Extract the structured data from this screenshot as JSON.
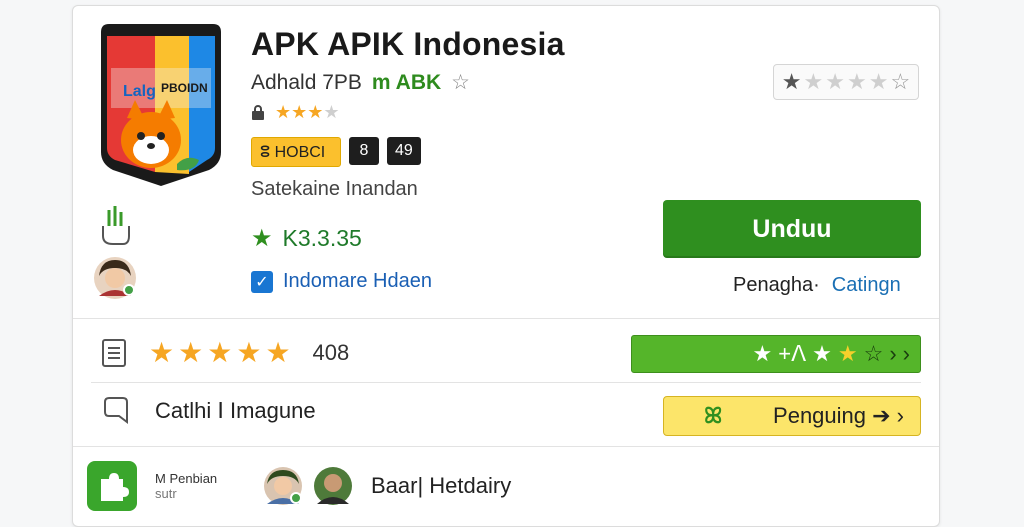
{
  "app": {
    "title": "APK APIK Indonesia",
    "developer": "Adhald 7PB",
    "developer_badge": "m ABK",
    "hollow_star": "☆",
    "chip_label": "ⵓ HOBCI",
    "chip_num1": "8",
    "chip_num2": "49",
    "subtitle": "Satekaine Inandan",
    "price": "K3.3.35",
    "checkbox_label": "Indomare Hdaen",
    "small_stars": [
      true,
      true,
      true,
      false
    ]
  },
  "actions": {
    "download_label": "Unduu",
    "meta_label": "Penagha·",
    "meta_link": "Catingn"
  },
  "rating_box": {
    "stars": [
      "on",
      "off",
      "off",
      "off",
      "off",
      "hollow"
    ]
  },
  "reviews": {
    "count": "408",
    "stars": 5,
    "bar_symbols": "★ +ⴷ ★ ★ ☆ › ›"
  },
  "section2": {
    "label": "Catlhi ⵏ Imagune",
    "button_symbol": "ꕤ",
    "button_label": "Penguing ➔ ›"
  },
  "footer": {
    "text_line1": "M Penbian",
    "text_line2": "sutr",
    "label": "Baar| Hetdairy"
  },
  "colors": {
    "accent_green": "#2f8f1f",
    "link_blue": "#1a6fb4",
    "star_yellow": "#f6a623",
    "bar_green": "#55b52a",
    "button_yellow": "#fce56a"
  }
}
